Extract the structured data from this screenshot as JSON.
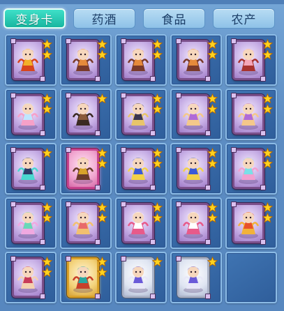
{
  "tabs": [
    {
      "label": "变身卡",
      "active": true
    },
    {
      "label": "药酒",
      "active": false
    },
    {
      "label": "食品",
      "active": false
    },
    {
      "label": "农产",
      "active": false
    }
  ],
  "colors": {
    "active_tab": "#1fc3ac",
    "inactive_tab": "#a6d0ee",
    "slot_bg": "#3a6aa8",
    "star": "#ffd21f"
  },
  "slots": [
    {
      "item": "transformation-card",
      "character": "golden-lion",
      "stars": 2,
      "frame": "purple",
      "palette": [
        "#f2b02a",
        "#d8441e"
      ]
    },
    {
      "item": "transformation-card",
      "character": "fox-warrior",
      "stars": 2,
      "frame": "purple",
      "palette": [
        "#e58a3b",
        "#7a3a2a"
      ]
    },
    {
      "item": "transformation-card",
      "character": "fox-warrior",
      "stars": 2,
      "frame": "purple",
      "palette": [
        "#e58a3b",
        "#7a3a2a"
      ]
    },
    {
      "item": "transformation-card",
      "character": "fox-warrior",
      "stars": 2,
      "frame": "purple",
      "palette": [
        "#e58a3b",
        "#7a3a2a"
      ]
    },
    {
      "item": "transformation-card",
      "character": "pig-spirit",
      "stars": 2,
      "frame": "purple",
      "palette": [
        "#f4a6b8",
        "#a8322f"
      ]
    },
    {
      "item": "transformation-card",
      "character": "ice-rabbit",
      "stars": 2,
      "frame": "purple",
      "palette": [
        "#bfe6ff",
        "#f6a0c8"
      ]
    },
    {
      "item": "transformation-card",
      "character": "bull-demon",
      "stars": 1,
      "frame": "purple",
      "palette": [
        "#8a5a3a",
        "#3a2a22"
      ]
    },
    {
      "item": "transformation-card",
      "character": "black-horse-rider",
      "stars": 2,
      "frame": "purple",
      "palette": [
        "#3a3550",
        "#e8c56a"
      ]
    },
    {
      "item": "transformation-card",
      "character": "purple-fairy",
      "stars": 2,
      "frame": "purple",
      "palette": [
        "#b06ad8",
        "#f4c88a"
      ]
    },
    {
      "item": "transformation-card",
      "character": "purple-fairy",
      "stars": 2,
      "frame": "purple",
      "palette": [
        "#b06ad8",
        "#f4c88a"
      ]
    },
    {
      "item": "transformation-card",
      "character": "dark-horse",
      "stars": 1,
      "frame": "purple",
      "palette": [
        "#2f3c6a",
        "#4ad8d0"
      ]
    },
    {
      "item": "transformation-card",
      "character": "golden-warrior",
      "stars": 2,
      "frame": "pink",
      "palette": [
        "#d8a22a",
        "#6a3a2a"
      ]
    },
    {
      "item": "transformation-card",
      "character": "armored-general",
      "stars": 2,
      "frame": "purple",
      "palette": [
        "#3a5ad8",
        "#f2d24a"
      ]
    },
    {
      "item": "transformation-card",
      "character": "armored-general",
      "stars": 2,
      "frame": "purple",
      "palette": [
        "#3a5ad8",
        "#f2d24a"
      ]
    },
    {
      "item": "transformation-card",
      "character": "water-spirit",
      "stars": 2,
      "frame": "purple",
      "palette": [
        "#7ae0e8",
        "#f2a0d0"
      ]
    },
    {
      "item": "transformation-card",
      "character": "butterfly-fairy",
      "stars": 2,
      "frame": "purple",
      "palette": [
        "#6ad8b8",
        "#f0a8e0"
      ]
    },
    {
      "item": "transformation-card",
      "character": "winged-girl",
      "stars": 2,
      "frame": "purple",
      "palette": [
        "#e86a6a",
        "#f2c070"
      ]
    },
    {
      "item": "transformation-card",
      "character": "jade-rabbit",
      "stars": 2,
      "frame": "purple",
      "palette": [
        "#ffffff",
        "#e85a8a"
      ]
    },
    {
      "item": "transformation-card",
      "character": "jade-rabbit",
      "stars": 2,
      "frame": "purple",
      "palette": [
        "#ffffff",
        "#e85a8a"
      ]
    },
    {
      "item": "transformation-card",
      "character": "fire-monkey",
      "stars": 2,
      "frame": "purple",
      "palette": [
        "#e8502a",
        "#f2b23a"
      ]
    },
    {
      "item": "transformation-card",
      "character": "dancing-maiden",
      "stars": 2,
      "frame": "purple",
      "palette": [
        "#c83a5a",
        "#f4d0b0"
      ]
    },
    {
      "item": "transformation-card",
      "character": "celestial-warrior",
      "stars": 2,
      "frame": "gold",
      "palette": [
        "#2aa8a0",
        "#c8402a"
      ]
    },
    {
      "item": "transformation-card",
      "character": "silver-knight",
      "stars": 1,
      "frame": "silver",
      "palette": [
        "#6a5ad8",
        "#e8e8f8"
      ]
    },
    {
      "item": "transformation-card",
      "character": "silver-knight",
      "stars": 1,
      "frame": "silver",
      "palette": [
        "#6a5ad8",
        "#e8e8f8"
      ]
    },
    {
      "item": "empty"
    }
  ]
}
